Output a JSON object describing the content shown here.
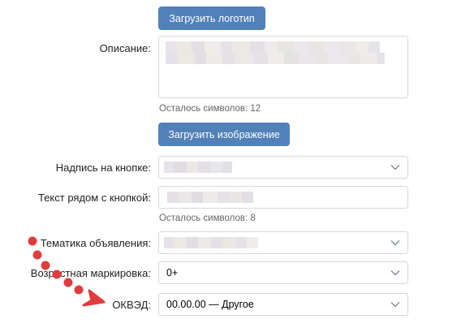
{
  "buttons": {
    "upload_logo": "Загрузить логотип",
    "upload_image": "Загрузить изображение"
  },
  "description": {
    "label": "Описание:",
    "hint": "Осталось символов: 12"
  },
  "button_caption": {
    "label": "Надпись на кнопке:"
  },
  "text_near_button": {
    "label": "Текст рядом с кнопкой:",
    "hint": "Осталось символов: 8"
  },
  "ad_topic": {
    "label": "Тематика объявления:"
  },
  "age_rating": {
    "label": "Возрастная маркировка:",
    "value": "0+"
  },
  "okved": {
    "label": "ОКВЭД:",
    "value": "00.00.00 — Другое"
  },
  "colors": {
    "button": "#5181b8",
    "border": "#d3d9de",
    "annotation_arrow": "#e03c3c"
  },
  "icons": {
    "select_chevron": "chevron-down-icon",
    "annotation": "dotted-arrow"
  }
}
